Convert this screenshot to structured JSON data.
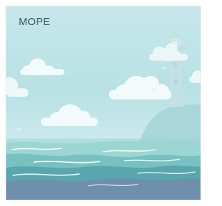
{
  "card": {
    "title": "МОРЕ"
  },
  "colors": {
    "sky_top": "#c6e7ea",
    "sky_bottom": "#a6d9dc",
    "cloud": "#f2fafb",
    "lighthouse": "#c2e1e4",
    "cliff": "#a4d4d6",
    "sea_light": "#9cd6d2",
    "sea_mid": "#78c1c1",
    "sea_dark": "#5aa6ae",
    "sea_deep": "#6f90ad",
    "foam": "#ffffff"
  },
  "icons": {
    "scene": "sea-with-lighthouse-illustration"
  }
}
